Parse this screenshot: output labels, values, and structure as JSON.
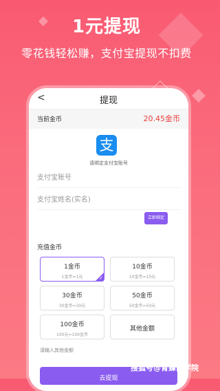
{
  "headline": "1元提现",
  "subline": "零花钱轻松赚，支付宝提现不扣费",
  "nav": {
    "back": "<",
    "title": "提现"
  },
  "balance": {
    "label": "当前金币",
    "value": "20.45金币"
  },
  "alipay": {
    "icon_glyph": "支",
    "bind_hint": "请绑定支付宝账号"
  },
  "form": {
    "account_placeholder": "支付宝账号",
    "name_placeholder": "支付宝姓名(实名)",
    "bind_button": "立即绑定"
  },
  "recharge": {
    "label": "充值金币",
    "options": [
      {
        "main": "1金币",
        "sub": "1金币=1元"
      },
      {
        "main": "10金币",
        "sub": "10金币=10元"
      },
      {
        "main": "30金币",
        "sub": "30金币=30元"
      },
      {
        "main": "50金币",
        "sub": "50金币=50元"
      },
      {
        "main": "100金币",
        "sub": "100元=100金币"
      },
      {
        "main": "其他金额",
        "sub": ""
      }
    ],
    "custom_hint": "请输入其他金额",
    "submit": "去提现"
  },
  "watermark": "搜狐号@青蜂商学院",
  "colors": {
    "accent": "#8a5cf0",
    "balance": "#e8413e",
    "alipay": "#1a8df0"
  }
}
